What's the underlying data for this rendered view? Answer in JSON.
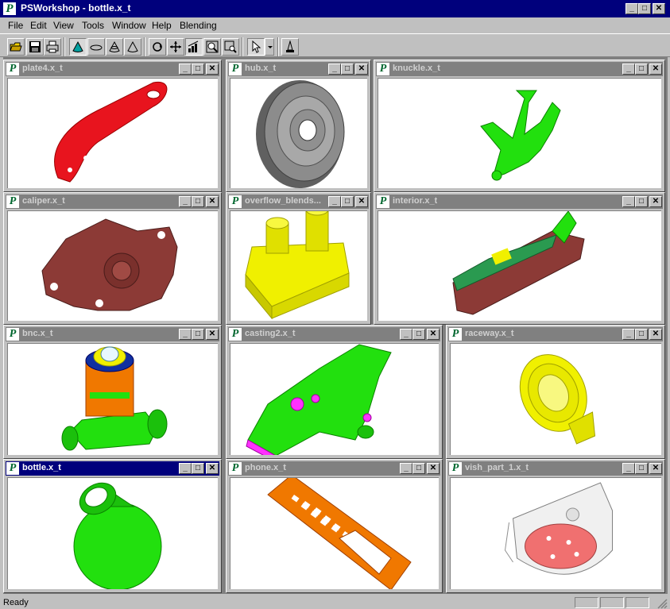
{
  "app": {
    "title": "PSWorkshop - bottle.x_t",
    "logo_letter": "P"
  },
  "menu": [
    {
      "label": "File"
    },
    {
      "label": "Edit"
    },
    {
      "label": "View"
    },
    {
      "label": "Tools"
    },
    {
      "label": "Window"
    },
    {
      "label": "Help"
    },
    {
      "label": "Blending"
    }
  ],
  "toolbar": {
    "icons": [
      "open-icon",
      "save-icon",
      "print-icon",
      "cone-shaded-icon",
      "disc-icon",
      "cone-wire-icon",
      "cone-outline-icon",
      "rotate-icon",
      "pan-icon",
      "graph-icon",
      "zoom-icon",
      "zoom-window-icon",
      "select-arrow-icon",
      "dropdown-icon",
      "pick-icon"
    ],
    "pressed": [
      "cone-shaded-icon",
      "graph-icon",
      "select-arrow-icon"
    ]
  },
  "windows": [
    {
      "title": "plate4.x_t",
      "active": false,
      "part": "plate",
      "color": "#e8141e"
    },
    {
      "title": "hub.x_t",
      "active": false,
      "part": "hub",
      "color": "#8c8c8c"
    },
    {
      "title": "knuckle.x_t",
      "active": false,
      "part": "knuckle",
      "color": "#22e00e"
    },
    {
      "title": "caliper.x_t",
      "active": false,
      "part": "caliper",
      "color": "#8c3a36"
    },
    {
      "title": "overflow_blends...",
      "active": false,
      "part": "overflow",
      "color": "#f0f000"
    },
    {
      "title": "interior.x_t",
      "active": false,
      "part": "interior",
      "color": "#8c3a36"
    },
    {
      "title": "bnc.x_t",
      "active": false,
      "part": "bnc",
      "color": "#22e00e"
    },
    {
      "title": "casting2.x_t",
      "active": false,
      "part": "casting",
      "color": "#22e00e"
    },
    {
      "title": "raceway.x_t",
      "active": false,
      "part": "raceway",
      "color": "#f0f000"
    },
    {
      "title": "bottle.x_t",
      "active": true,
      "part": "bottle",
      "color": "#22e00e"
    },
    {
      "title": "phone.x_t",
      "active": false,
      "part": "phone",
      "color": "#f07800"
    },
    {
      "title": "vish_part_1.x_t",
      "active": false,
      "part": "vish",
      "color": "#f0f0f0"
    }
  ],
  "status": {
    "text": "Ready"
  }
}
